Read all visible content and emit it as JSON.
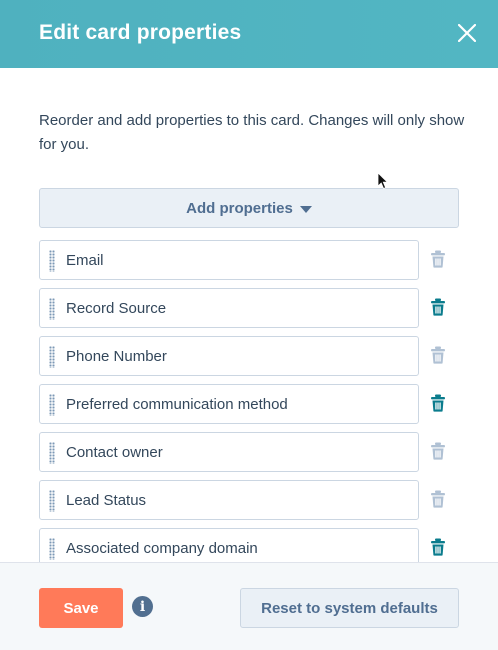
{
  "dialog": {
    "title": "Edit card properties",
    "description": "Reorder and add properties to this card. Changes will only show for you.",
    "add_properties_label": "Add properties"
  },
  "properties": [
    {
      "label": "Email",
      "removable": false
    },
    {
      "label": "Record Source",
      "removable": true
    },
    {
      "label": "Phone Number",
      "removable": false
    },
    {
      "label": "Preferred communication method",
      "removable": true
    },
    {
      "label": "Contact owner",
      "removable": false
    },
    {
      "label": "Lead Status",
      "removable": false
    },
    {
      "label": "Associated company domain",
      "removable": true
    }
  ],
  "footer": {
    "save_label": "Save",
    "reset_label": "Reset to system defaults",
    "info_icon": "i"
  },
  "colors": {
    "header": "#52b6c3",
    "save": "#ff7a59",
    "trash_active": "#0b7c8d",
    "trash_disabled": "#b0c1d4"
  },
  "icons": {
    "close": "close-icon",
    "caret": "caret-down-icon",
    "grip": "drag-handle-icon",
    "trash": "trash-icon",
    "info": "info-icon"
  }
}
